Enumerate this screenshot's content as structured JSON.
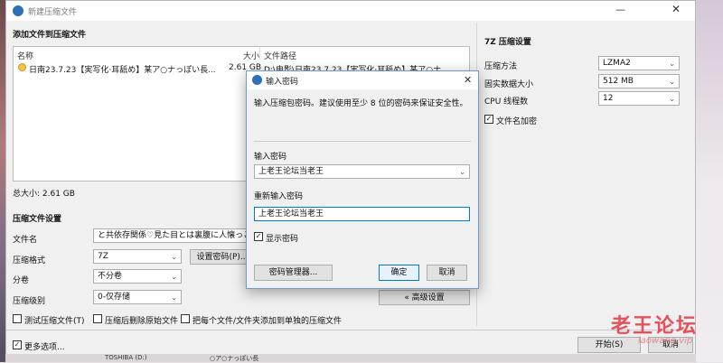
{
  "window": {
    "title": "新建压缩文件",
    "add_section": "添加文件到压缩文件",
    "table": {
      "col_name": "名称",
      "col_size": "大小",
      "col_path": "文件路径",
      "rows": [
        {
          "name": "日南23.7.23【実写化·耳舐め】某ア○ナっぽい長...",
          "size": "2.61 GB",
          "path": "D:\\电影\\日南23.7.23【実写化·耳舐め】某ア○ナ..."
        }
      ]
    },
    "total_size": "总大小: 2.61 GB",
    "compress_settings": "压缩文件设置",
    "filename_label": "文件名",
    "filename_value": "と共依存関係♡見た目とは裏腹に人懐っこく♡ス",
    "format_label": "压缩格式",
    "format_value": "7Z",
    "set_password_button": "设置密码(P)...",
    "split_label": "分卷",
    "split_value": "不分卷",
    "level_label": "压缩级别",
    "level_value": "0-仅存储",
    "advanced_button": "« 高级设置",
    "test_checkbox": "测试压缩文件(T)",
    "delete_checkbox": "压缩后删除原始文件",
    "separate_checkbox": "把每个文件/文件夹添加到单独的压缩文件",
    "more_options": "更多选项...",
    "start_button": "开始(S)",
    "cancel_button": "取消"
  },
  "seven_z": {
    "title": "7Z 压缩设置",
    "method_label": "压缩方法",
    "method_value": "LZMA2",
    "dict_label": "固实数据大小",
    "dict_value": "512 MB",
    "threads_label": "CPU 线程数",
    "threads_value": "12",
    "encrypt_names": "文件名加密"
  },
  "dialog": {
    "title": "输入密码",
    "hint": "输入压缩包密码。建议使用至少 8 位的密码来保证安全性。",
    "enter_label": "输入密码",
    "enter_value": "上老王论坛当老王",
    "reenter_label": "重新输入密码",
    "reenter_value": "上老王论坛当老王",
    "show_password": "显示密码",
    "manager_button": "密码管理器...",
    "ok_button": "确定",
    "cancel_button": "取消"
  },
  "watermark": {
    "text": "老王论坛",
    "url": "laowang.vip"
  },
  "taskbar": {
    "item1": "TOSHIBA (D:)",
    "item2": "○ア○ナっぽい長"
  }
}
